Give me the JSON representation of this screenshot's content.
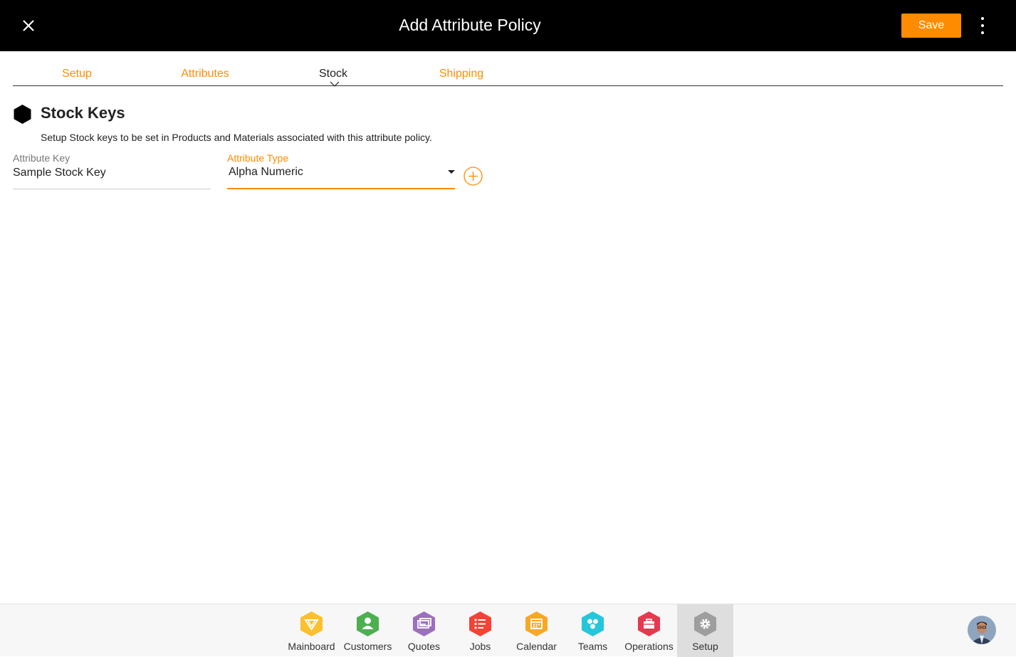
{
  "header": {
    "title": "Add Attribute Policy",
    "save_label": "Save"
  },
  "tabs": [
    {
      "label": "Setup",
      "active": false
    },
    {
      "label": "Attributes",
      "active": false
    },
    {
      "label": "Stock",
      "active": true
    },
    {
      "label": "Shipping",
      "active": false
    }
  ],
  "section": {
    "title": "Stock Keys",
    "description": "Setup Stock keys to be set in Products and Materials associated with this attribute policy."
  },
  "fields": {
    "attribute_key": {
      "label": "Attribute Key",
      "value": "Sample Stock Key"
    },
    "attribute_type": {
      "label": "Attribute Type",
      "value": "Alpha Numeric"
    }
  },
  "nav": [
    {
      "label": "Mainboard",
      "color": "#fbc02d",
      "icon": "mainboard-icon"
    },
    {
      "label": "Customers",
      "color": "#4caf50",
      "icon": "customer-icon"
    },
    {
      "label": "Quotes",
      "color": "#9c6fc0",
      "icon": "quotes-icon"
    },
    {
      "label": "Jobs",
      "color": "#f44336",
      "icon": "jobs-icon"
    },
    {
      "label": "Calendar",
      "color": "#f9a825",
      "icon": "calendar-icon"
    },
    {
      "label": "Teams",
      "color": "#26c6da",
      "icon": "teams-icon"
    },
    {
      "label": "Operations",
      "color": "#e53950",
      "icon": "operations-icon"
    },
    {
      "label": "Setup",
      "color": "#9e9e9e",
      "icon": "gear-icon"
    }
  ],
  "colors": {
    "accent": "#ff8c00",
    "header_bg": "#000000"
  }
}
